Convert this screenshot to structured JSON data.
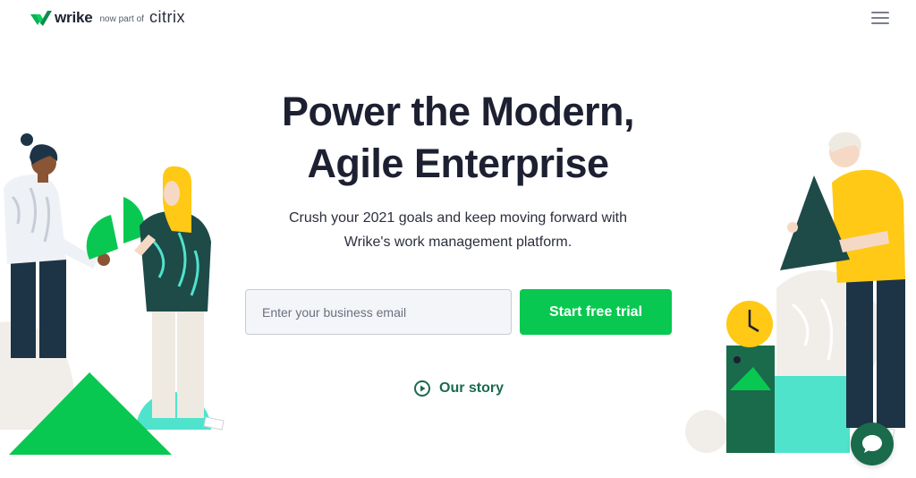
{
  "header": {
    "logo_word": "wrike",
    "logo_part": "now part of",
    "logo_partner": "citrix",
    "menu_icon": "hamburger-menu-icon"
  },
  "hero": {
    "title_line1": "Power the Modern,",
    "title_line2": "Agile Enterprise",
    "subtitle_line1": "Crush your 2021 goals and keep moving forward with",
    "subtitle_line2": "Wrike's work management platform."
  },
  "signup": {
    "email_placeholder": "Enter your business email",
    "email_value": "",
    "cta_label": "Start free trial"
  },
  "story": {
    "label": "Our story",
    "icon": "play-circle-icon"
  },
  "chat": {
    "icon": "chat-bubble-icon"
  },
  "colors": {
    "brand_green": "#09c851",
    "dark_green": "#1b6a4f",
    "navy": "#1d2031",
    "teal": "#4fe3cc",
    "yellow": "#ffc915"
  }
}
